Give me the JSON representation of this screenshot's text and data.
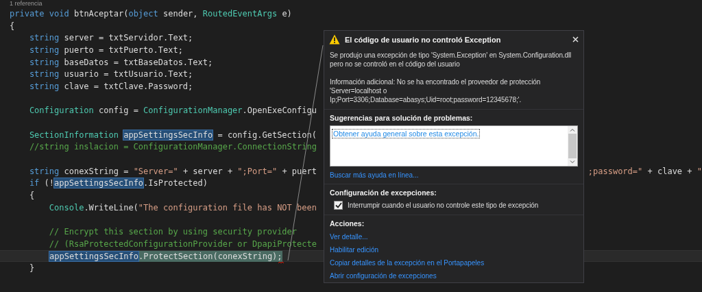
{
  "editor": {
    "reference": "1 referencia",
    "lines": [
      {
        "current": false,
        "tokens": [
          {
            "kind": "keyword",
            "text": "private "
          },
          {
            "kind": "keyword",
            "text": "void"
          },
          {
            "kind": "plain",
            "text": " btnAceptar("
          },
          {
            "kind": "keyword",
            "text": "object"
          },
          {
            "kind": "plain",
            "text": " sender, "
          },
          {
            "kind": "type",
            "text": "RoutedEventArgs"
          },
          {
            "kind": "plain",
            "text": " e)"
          }
        ]
      },
      {
        "current": false,
        "tokens": [
          {
            "kind": "plain",
            "text": "{"
          }
        ]
      },
      {
        "current": false,
        "tokens": [
          {
            "kind": "keyword",
            "text": "    string"
          },
          {
            "kind": "plain",
            "text": " server = txtServidor.Text;"
          }
        ]
      },
      {
        "current": false,
        "tokens": [
          {
            "kind": "keyword",
            "text": "    string"
          },
          {
            "kind": "plain",
            "text": " puerto = txtPuerto.Text;"
          }
        ]
      },
      {
        "current": false,
        "tokens": [
          {
            "kind": "keyword",
            "text": "    string"
          },
          {
            "kind": "plain",
            "text": " baseDatos = txtBaseDatos.Text;"
          }
        ]
      },
      {
        "current": false,
        "tokens": [
          {
            "kind": "keyword",
            "text": "    string"
          },
          {
            "kind": "plain",
            "text": " usuario = txtUsuario.Text;"
          }
        ]
      },
      {
        "current": false,
        "tokens": [
          {
            "kind": "keyword",
            "text": "    string"
          },
          {
            "kind": "plain",
            "text": " clave = txtClave.Password;"
          }
        ]
      },
      {
        "current": false
      },
      {
        "current": false,
        "tokens": [
          {
            "kind": "type",
            "text": "    Configuration"
          },
          {
            "kind": "plain",
            "text": " config = "
          },
          {
            "kind": "type",
            "text": "ConfigurationManager"
          },
          {
            "kind": "plain",
            "text": ".OpenExeConfigu"
          }
        ]
      },
      {
        "current": false
      },
      {
        "current": false,
        "tokens": [
          {
            "kind": "type",
            "text": "    SectionInformation "
          },
          {
            "kind": "match",
            "text": "appSettingsSecInfo"
          },
          {
            "kind": "plain",
            "text": " = config.GetSection("
          }
        ]
      },
      {
        "current": false,
        "tokens": [
          {
            "kind": "comment",
            "text": "    //string inslacion = ConfigurationManager.ConnectionString"
          }
        ]
      },
      {
        "current": false
      },
      {
        "current": false,
        "tokens": [
          {
            "kind": "keyword",
            "text": "    string"
          },
          {
            "kind": "plain",
            "text": " conexString = "
          },
          {
            "kind": "string",
            "text": "\"Server=\""
          },
          {
            "kind": "plain",
            "text": " + server + "
          },
          {
            "kind": "string",
            "text": "\";Port=\""
          },
          {
            "kind": "plain",
            "text": " + puert"
          }
        ],
        "tail": [
          {
            "kind": "string",
            "text": ";password=\""
          },
          {
            "kind": "plain",
            "text": " + clave + "
          },
          {
            "kind": "string",
            "text": "\""
          }
        ]
      },
      {
        "current": false,
        "tokens": [
          {
            "kind": "keyword",
            "text": "    if"
          },
          {
            "kind": "plain",
            "text": " (!"
          },
          {
            "kind": "match",
            "text": "appSettingsSecInfo"
          },
          {
            "kind": "plain",
            "text": ".IsProtected)"
          }
        ]
      },
      {
        "current": false,
        "tokens": [
          {
            "kind": "plain",
            "text": "    {"
          }
        ]
      },
      {
        "current": false,
        "tokens": [
          {
            "kind": "type",
            "text": "        Console"
          },
          {
            "kind": "plain",
            "text": ".WriteLine("
          },
          {
            "kind": "string",
            "text": "\"The configuration file has NOT been"
          }
        ]
      },
      {
        "current": false
      },
      {
        "current": false,
        "tokens": [
          {
            "kind": "comment",
            "text": "        // Encrypt this section by using security provider"
          }
        ]
      },
      {
        "current": false,
        "tokens": [
          {
            "kind": "comment",
            "text": "        // (RsaProtectedConfigurationProvider or DpapiProtecte"
          }
        ]
      },
      {
        "current": true,
        "tokens": [
          {
            "kind": "match",
            "text": "appSettingsSecInfo"
          },
          {
            "kind": "plain",
            "text": ".ProtectSection(conexString);"
          }
        ]
      },
      {
        "current": false,
        "tokens": [
          {
            "kind": "plain",
            "text": "    }"
          }
        ]
      }
    ]
  },
  "exception_popup": {
    "title": "El código de usuario no controló Exception",
    "message": "Se produjo una excepción de tipo 'System.Exception' en System.Configuration.dll pero no se controló en el código del usuario",
    "additional_info": "Información adicional: No se ha encontrado el proveedor de protección 'Server=localhost o Ip;Port=3306;Database=abasys;Uid=root;password=12345678;'.",
    "troubleshooting": {
      "heading": "Sugerencias para solución de problemas:",
      "items": [
        {
          "label": "Obtener ayuda general sobre esta excepción.",
          "selected": true
        }
      ],
      "more_help": "Buscar más ayuda en línea..."
    },
    "exception_settings": {
      "heading": "Configuración de excepciones:",
      "options": [
        {
          "label": "Interrumpir cuando el usuario no controle este tipo de excepción",
          "checked": true
        }
      ]
    },
    "actions": {
      "heading": "Acciones:",
      "links": [
        "Ver detalle...",
        "Habilitar edición",
        "Copiar detalles de la excepción en el Portapapeles",
        "Abrir configuración de excepciones"
      ]
    }
  }
}
